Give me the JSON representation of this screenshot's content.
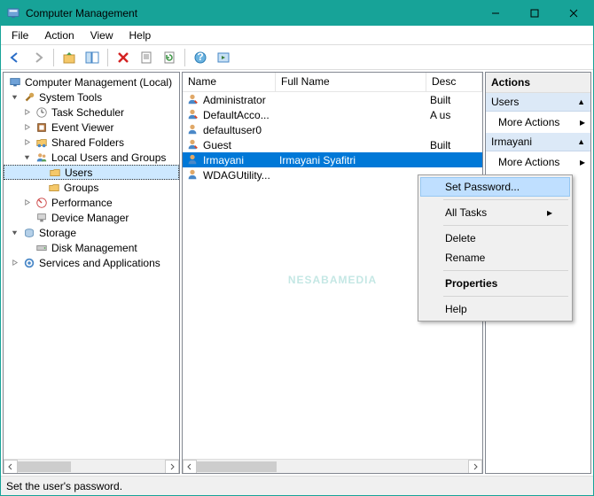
{
  "window": {
    "title": "Computer Management"
  },
  "menubar": {
    "file": "File",
    "action": "Action",
    "view": "View",
    "help": "Help"
  },
  "tree": {
    "root": "Computer Management (Local)",
    "systools": "System Tools",
    "taskscheduler": "Task Scheduler",
    "eventviewer": "Event Viewer",
    "sharedfolders": "Shared Folders",
    "localusers": "Local Users and Groups",
    "users": "Users",
    "groups": "Groups",
    "performance": "Performance",
    "devicemgr": "Device Manager",
    "storage": "Storage",
    "diskmgmt": "Disk Management",
    "services": "Services and Applications"
  },
  "list": {
    "cols": {
      "name": "Name",
      "fullname": "Full Name",
      "desc": "Desc"
    },
    "rows": [
      {
        "name": "Administrator",
        "fullname": "",
        "desc": "Built"
      },
      {
        "name": "DefaultAcco...",
        "fullname": "",
        "desc": "A us"
      },
      {
        "name": "defaultuser0",
        "fullname": "",
        "desc": ""
      },
      {
        "name": "Guest",
        "fullname": "",
        "desc": "Built"
      },
      {
        "name": "Irmayani",
        "fullname": "Irmayani Syafitri",
        "desc": ""
      },
      {
        "name": "WDAGUtility...",
        "fullname": "",
        "desc": ""
      }
    ]
  },
  "actions": {
    "title": "Actions",
    "group1": "Users",
    "more1": "More Actions",
    "group2": "Irmayani",
    "more2": "More Actions"
  },
  "ctx": {
    "setpw": "Set Password...",
    "alltasks": "All Tasks",
    "delete": "Delete",
    "rename": "Rename",
    "properties": "Properties",
    "help": "Help"
  },
  "status": "Set the user's password.",
  "watermark": {
    "main": "NESABAMEDIA"
  }
}
